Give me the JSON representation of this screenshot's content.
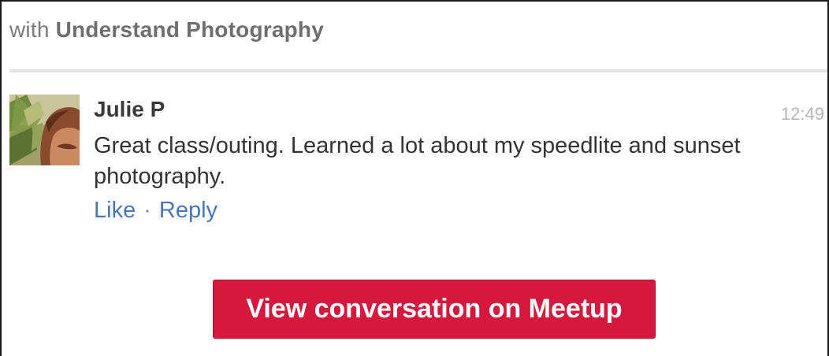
{
  "header": {
    "prefix": "with",
    "group_name": "Understand Photography"
  },
  "comment": {
    "author": "Julie P",
    "timestamp": "12:49",
    "text": "Great class/outing. Learned a lot about my speedlite and sunset photography.",
    "actions": {
      "like": "Like",
      "separator": "·",
      "reply": "Reply"
    }
  },
  "cta": {
    "label": "View conversation on Meetup"
  },
  "colors": {
    "link": "#4a77b4",
    "cta_background": "#d6183e",
    "divider": "#e3e3e3"
  },
  "icons": {
    "avatar": "user-photo-avatar"
  }
}
